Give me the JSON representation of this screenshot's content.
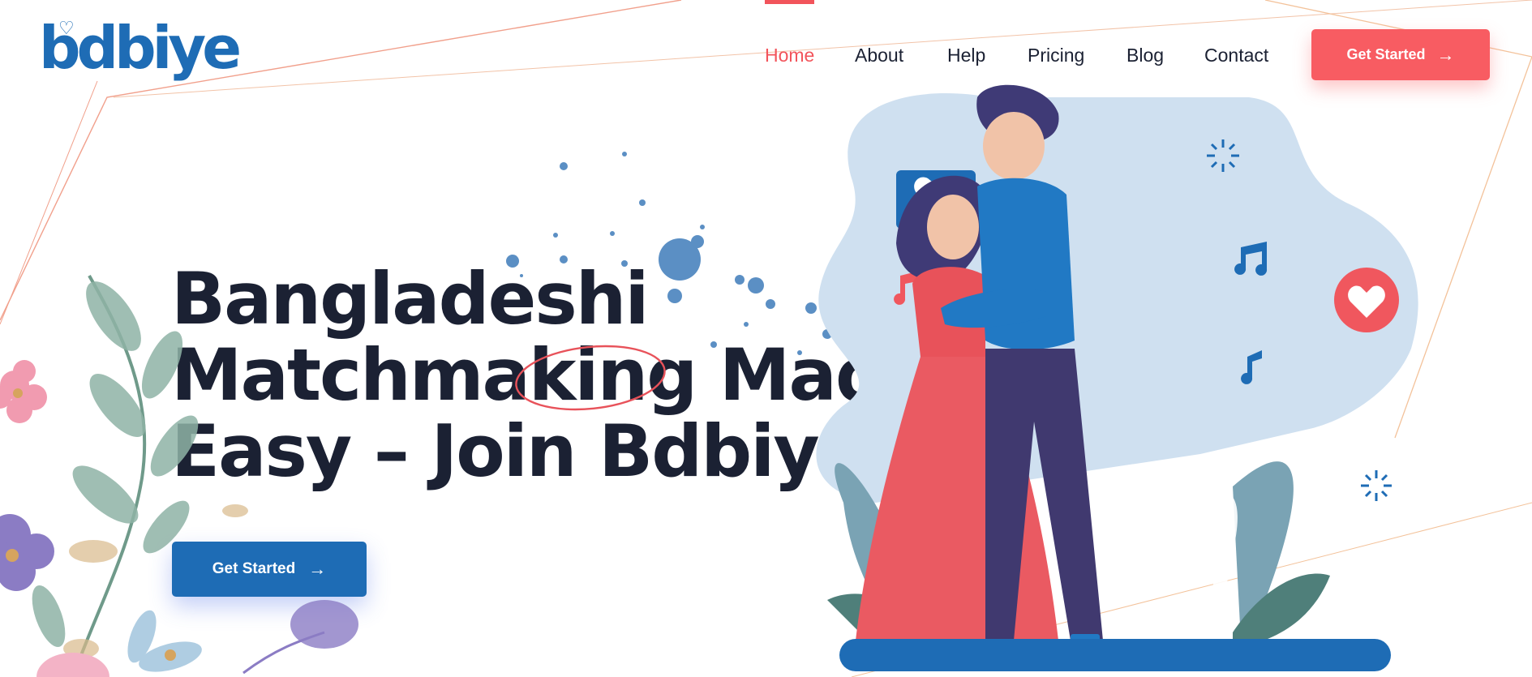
{
  "brand": {
    "logo_text": "bdbiye"
  },
  "nav": {
    "items": [
      {
        "label": "Home",
        "active": true
      },
      {
        "label": "About",
        "active": false
      },
      {
        "label": "Help",
        "active": false
      },
      {
        "label": "Pricing",
        "active": false
      },
      {
        "label": "Blog",
        "active": false
      },
      {
        "label": "Contact",
        "active": false
      }
    ],
    "cta_label": "Get Started"
  },
  "hero": {
    "title_lines": [
      "Bangladeshi",
      "Matchmaking Made",
      "Easy – Join Bdbiye"
    ],
    "cta_label": "Get Started"
  },
  "colors": {
    "accent": "#f2545b",
    "brand_blue": "#1e6cb5",
    "heading": "#1b2133",
    "blob": "#cfe0f0"
  },
  "icons": [
    "heart-icon",
    "music-note-icon",
    "arrow-right-icon",
    "sparkle-icon"
  ]
}
